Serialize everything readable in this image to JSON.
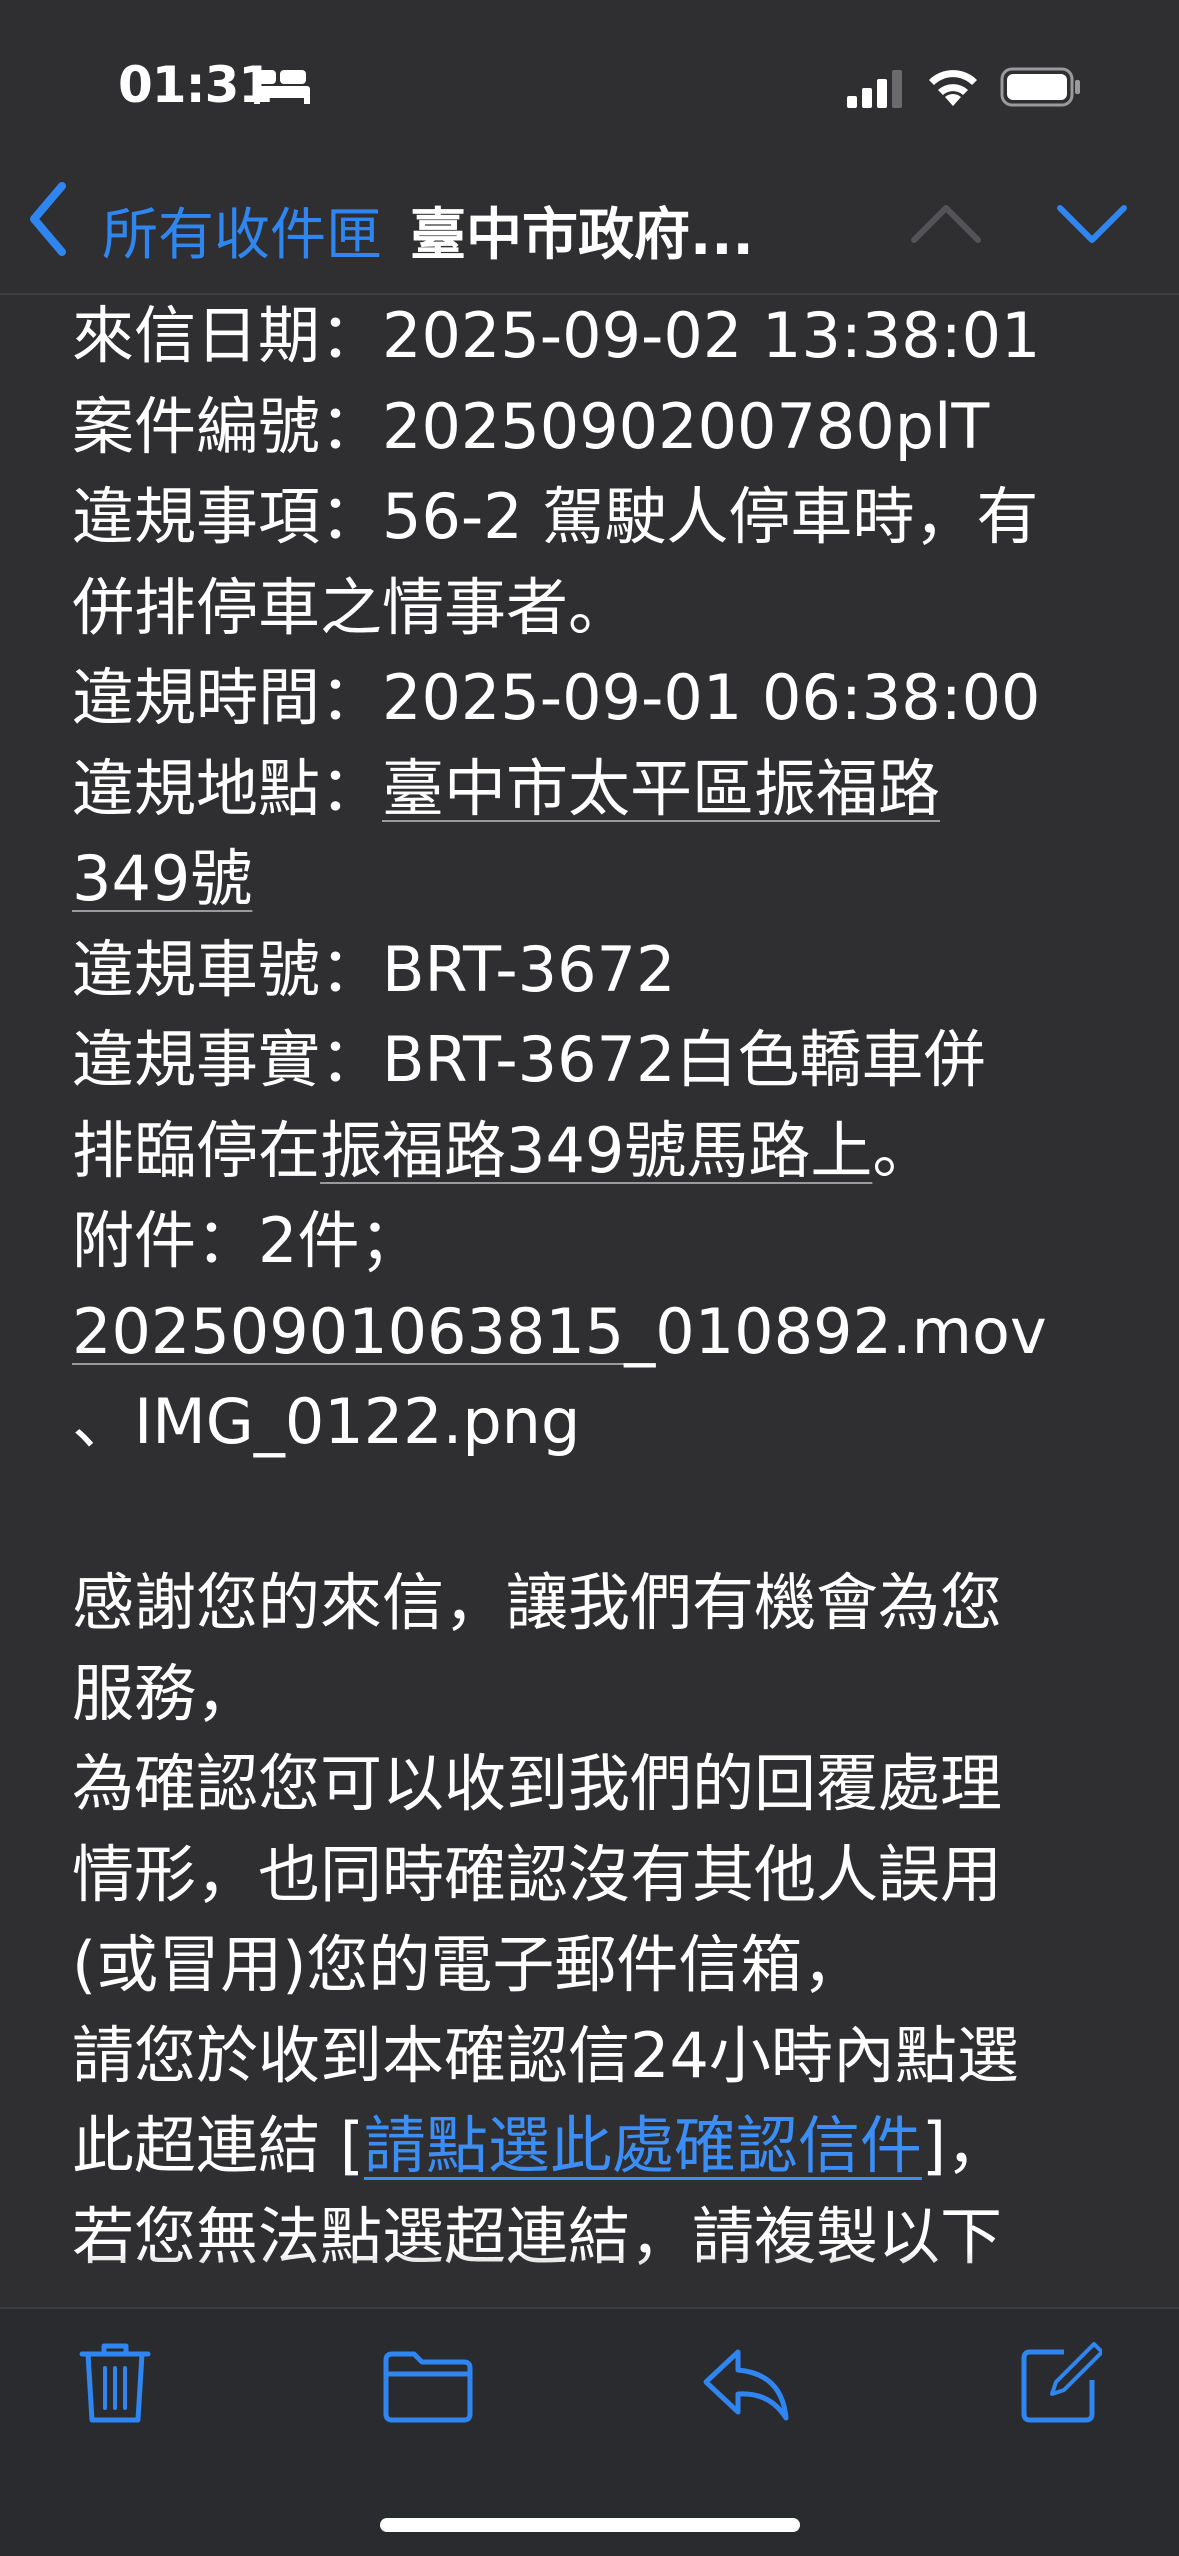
{
  "status_bar": {
    "time": "01:31",
    "icons": [
      "bed-icon",
      "signal-icon",
      "wifi-icon",
      "battery-icon"
    ]
  },
  "nav": {
    "back_label": "所有收件匣",
    "title": "臺中市政府...",
    "icons": [
      "chevron-left-icon",
      "chevron-up-icon",
      "chevron-down-icon"
    ]
  },
  "email": {
    "date_line": "來信日期：2025-09-02 13:38:01",
    "case_line": "案件編號：2025090200780plT",
    "violation_item_1": "違規事項：56-2 駕駛人停車時，有",
    "violation_item_2": "併排停車之情事者。",
    "violation_time": "違規時間：2025-09-01 06:38:00",
    "location_prefix": "違規地點：",
    "location_1": "臺中市太平區振福路",
    "location_2": "349號",
    "plate_line": "違規車號：BRT-3672",
    "fact_1": "違規事實：BRT-3672白色轎車併",
    "fact_2_a": "排臨停在",
    "fact_2_b": "振福路349號馬路上",
    "fact_2_c": "。",
    "attach_1": "附件：2件；",
    "attach_2_a": "20250901063815",
    "attach_2_b": "_010892.mov",
    "attach_3": "、IMG_0122.png",
    "thanks_1": "感謝您的來信，讓我們有機會為您",
    "thanks_2": "服務，",
    "confirm_1": "為確認您可以收到我們的回覆處理",
    "confirm_2": "情形，也同時確認沒有其他人誤用",
    "confirm_3": "(或冒用)您的電子郵件信箱，",
    "confirm_4": "請您於收到本確認信24小時內點選",
    "confirm_5_a": "此超連結 [",
    "confirm_5_link": "請點選此處確認信件",
    "confirm_5_b": "]，",
    "confirm_6": "若您無法點選超連結，請複製以下"
  },
  "toolbar": {
    "icons": [
      "trash-icon",
      "folder-icon",
      "reply-icon",
      "compose-icon"
    ]
  },
  "colors": {
    "background": "#2f2f31",
    "accent": "#2f86f0",
    "link": "#3b8ef5",
    "text": "#ffffff"
  }
}
